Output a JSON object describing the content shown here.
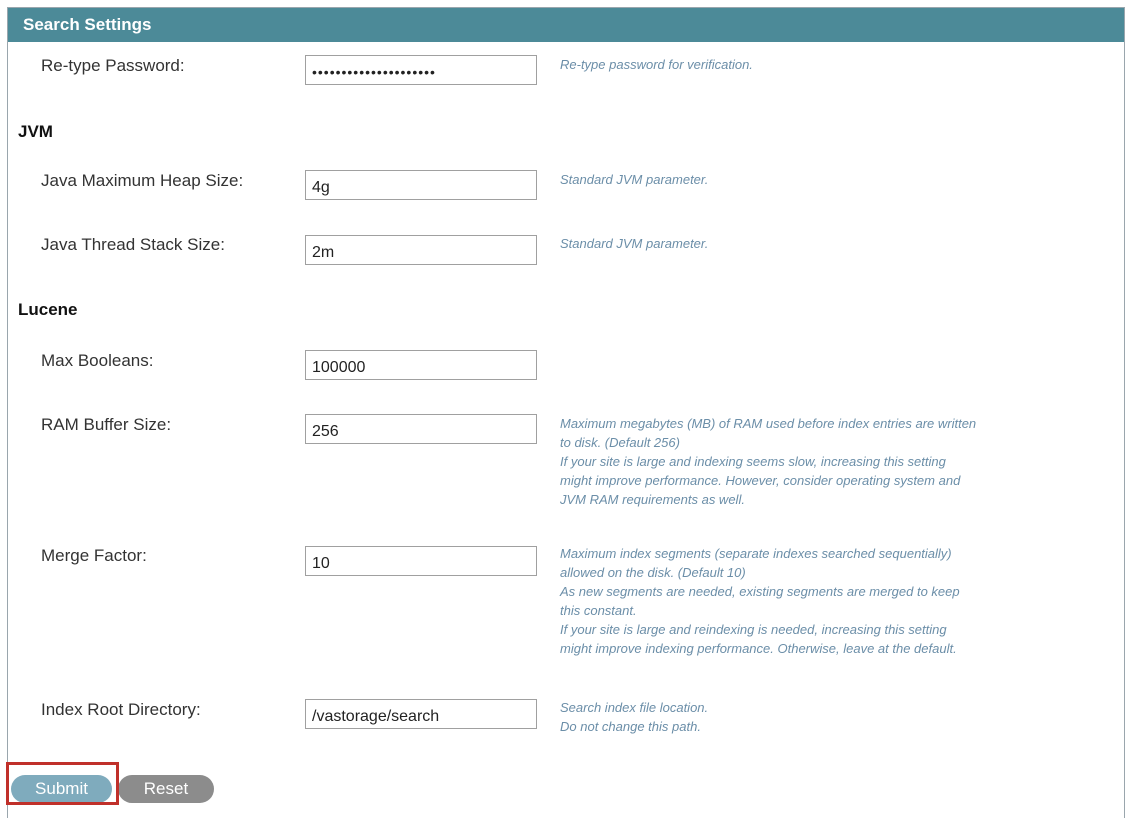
{
  "title": "Search Settings",
  "retype_password": {
    "label": "Re-type Password:",
    "value": "•••••••••••••••••••••",
    "help": "Re-type password for verification."
  },
  "jvm": {
    "heading": "JVM",
    "heap": {
      "label": "Java Maximum Heap Size:",
      "value": "4g",
      "help": "Standard JVM parameter."
    },
    "stack": {
      "label": "Java Thread Stack Size:",
      "value": "2m",
      "help": "Standard JVM parameter."
    }
  },
  "lucene": {
    "heading": "Lucene",
    "max_booleans": {
      "label": "Max Booleans:",
      "value": "100000"
    },
    "ram_buffer": {
      "label": "RAM Buffer Size:",
      "value": "256",
      "help": [
        "Maximum megabytes (MB) of RAM used before index entries are written",
        "to disk. (Default 256)",
        "If your site is large and indexing seems slow, increasing this setting",
        "might improve performance. However, consider operating system and",
        "JVM RAM requirements as well."
      ]
    },
    "merge_factor": {
      "label": "Merge Factor:",
      "value": "10",
      "help": [
        "Maximum index segments (separate indexes searched sequentially)",
        "allowed on the disk. (Default 10)",
        "As new segments are needed, existing segments are merged to keep",
        "this constant.",
        "If your site is large and reindexing is needed, increasing this setting",
        "might improve indexing performance. Otherwise, leave at the default."
      ]
    },
    "index_root": {
      "label": "Index Root Directory:",
      "value": "/vastorage/search",
      "help": [
        "Search index file location.",
        "Do not change this path."
      ]
    }
  },
  "buttons": {
    "submit": "Submit",
    "reset": "Reset"
  },
  "colors": {
    "titlebar": "#4c8a98",
    "help_text": "#6b8ea8",
    "submit": "#7fabbd",
    "reset": "#8c8c8c",
    "highlight": "#c0302a"
  }
}
